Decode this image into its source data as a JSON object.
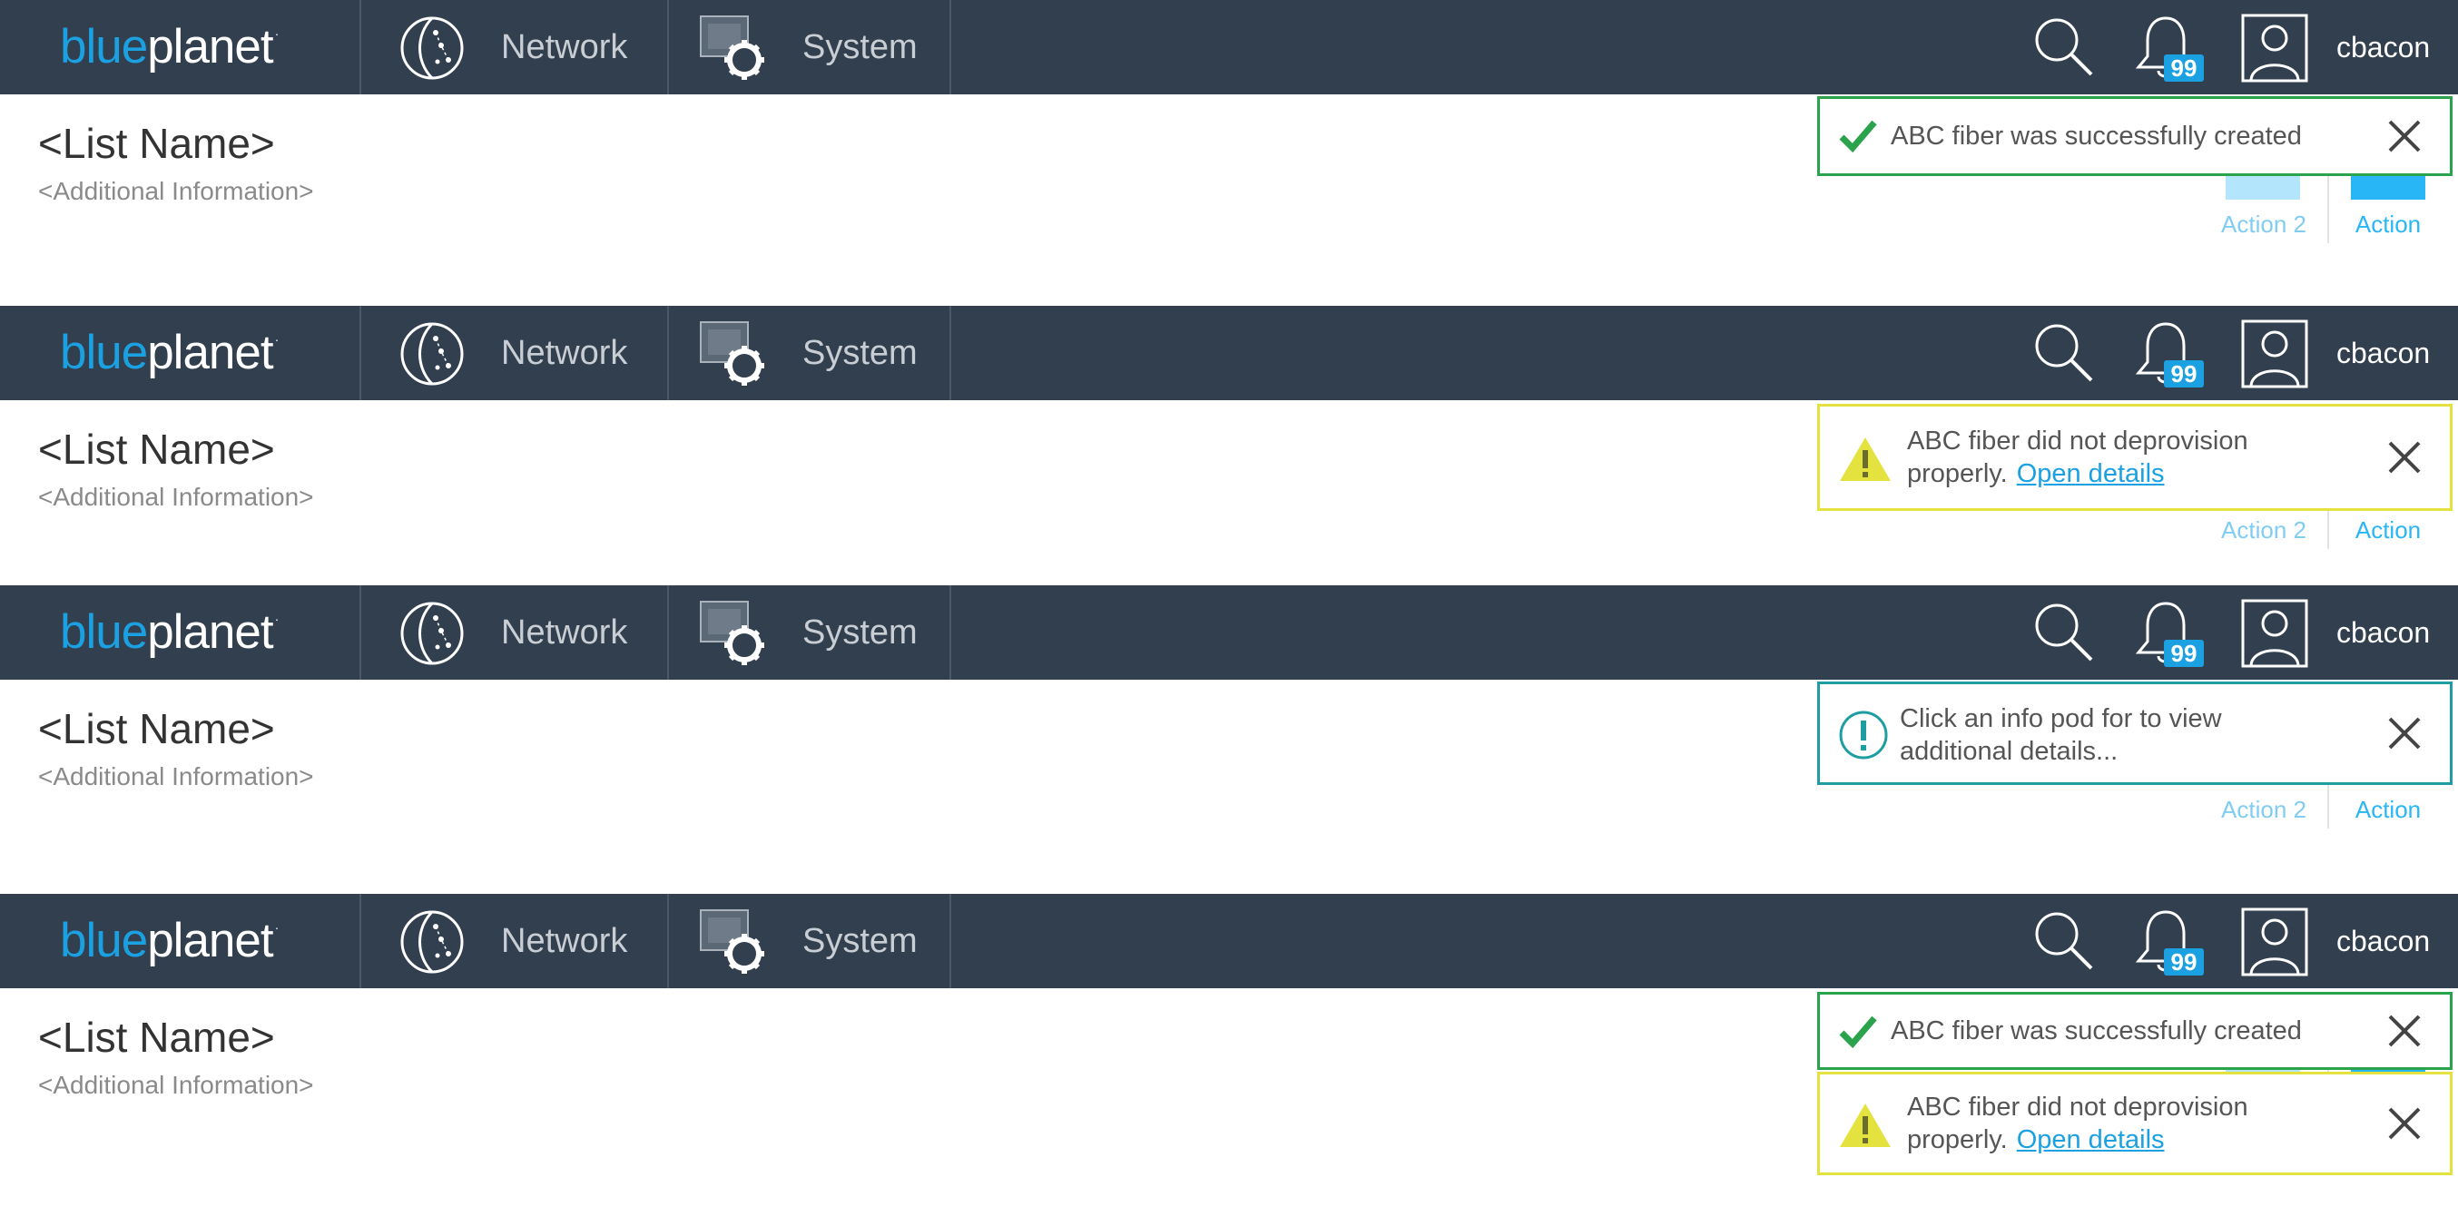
{
  "header": {
    "logo_part1": "blue",
    "logo_part2": "planet",
    "logo_mark": "·",
    "nav_network": "Network",
    "nav_system": "System",
    "notification_count": "99",
    "username": "cbacon"
  },
  "page": {
    "list_name": "<List Name>",
    "additional_info": "<Additional Information>",
    "action2_label": "Action 2",
    "action1_label": "Action",
    "icon_placeholder": "ICON"
  },
  "toasts": {
    "success_text": "ABC fiber was successfully created",
    "warning_line1": "ABC fiber did not deprovision",
    "warning_line2": "properly.",
    "warning_link": "Open details",
    "info_line1": "Click an info pod for to view",
    "info_line2": "additional details..."
  },
  "icons": {
    "nav_network": "network-globe-icon",
    "nav_system": "system-gear-icon",
    "search": "search-icon",
    "notifications": "bell-icon",
    "user": "user-avatar-icon",
    "success": "checkmark-icon",
    "warning": "warning-triangle-icon",
    "info": "info-circle-icon",
    "close": "close-icon"
  },
  "colors": {
    "topbar": "#323f4e",
    "brand_blue": "#1ba1e2",
    "success_border": "#2ba24c",
    "warning_border": "#e4e23f",
    "info_border": "#1e9ea0",
    "action_blue": "#29b6f6"
  }
}
